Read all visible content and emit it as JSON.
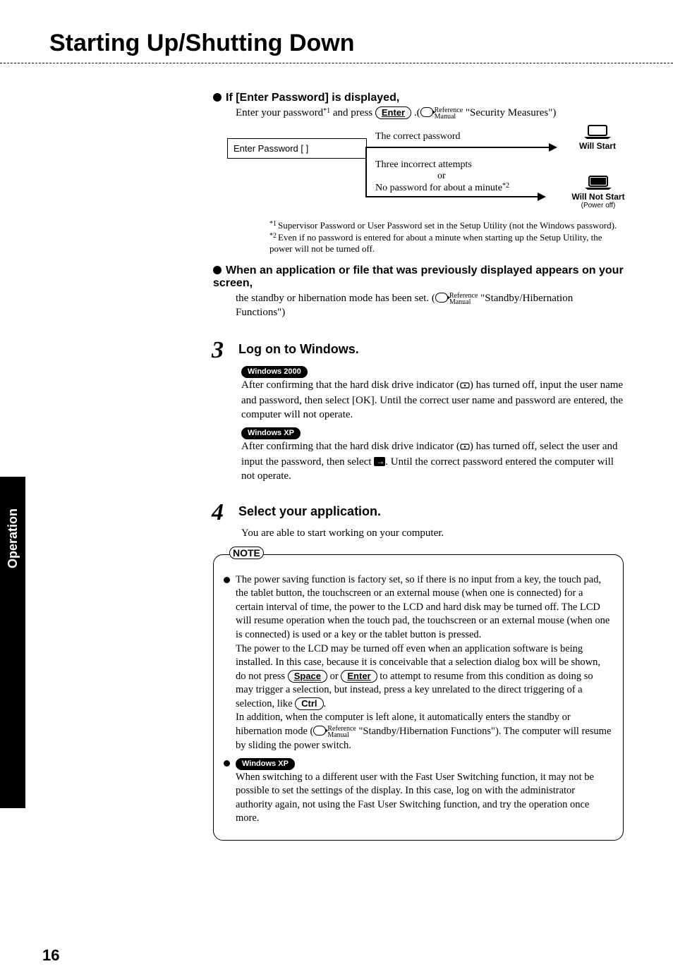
{
  "page": {
    "title": "Starting Up/Shutting Down",
    "number": "16",
    "tab": "Operation"
  },
  "section1": {
    "heading": "If [Enter Password] is displayed,",
    "intro_a": "Enter your password",
    "intro_sup": "*1",
    "intro_b": " and press ",
    "key_enter": "Enter",
    "intro_c": " .(",
    "ref1": "Reference",
    "ref2": "Manual",
    "intro_d": " \"Security Measures\")",
    "diagram": {
      "input_label": "Enter Password [       ]",
      "correct": "The correct password",
      "incorrect1": "Three incorrect attempts",
      "or": "or",
      "incorrect2": "No password for about a minute",
      "sup2": "*2",
      "will_start": "Will Start",
      "will_not_start": "Will Not Start",
      "power_off": "(Power off)"
    },
    "footnotes": {
      "f1": "Supervisor Password or User Password set in the Setup Utility (not the Windows password).",
      "f2": "Even if no password is entered for about a minute when starting up the Setup Utility, the power will not be turned off."
    }
  },
  "section2": {
    "heading": "When an application or file that was previously displayed appears on your screen,",
    "body_a": "the standby or hibernation mode has been set. (",
    "ref1": "Reference",
    "ref2": "Manual",
    "body_b": " \"Standby/Hibernation Functions\")"
  },
  "step3": {
    "num": "3",
    "title": "Log on to Windows.",
    "pill_2000": "Windows 2000",
    "body_2000": "After confirming that the hard disk drive indicator (    ) has turned off, input the user name and password, then select [OK].  Until the correct user name and password are entered, the computer will not operate.",
    "pill_xp": "Windows XP",
    "body_xp_a": "After confirming that the hard disk drive indicator (    ) has turned off, select the user and input the password, then select ",
    "body_xp_b": ".  Until the correct password entered the computer will not operate."
  },
  "step4": {
    "num": "4",
    "title": "Select your application.",
    "body": "You are able to start working on your computer."
  },
  "note": {
    "label": "NOTE",
    "b1_a": "The power saving function is factory set, so if there is no input from a key, the touch pad, the tablet button, the touchscreen or an external mouse (when one is connected) for a certain interval of time, the power to the LCD and hard disk may be turned off. The LCD will resume operation when the touch pad, the touchscreen or an external mouse (when one is connected) is used or a key or the tablet button is pressed.",
    "b1_b": "The power to the LCD may be turned off even when an application software is being installed.  In this case, because it is conceivable that a selection dialog box will be shown, do not press ",
    "key_space": "Space",
    "b1_c": " or ",
    "key_enter": "Enter",
    "b1_d": " to attempt to resume from this condition as doing so may trigger a selection, but instead, press a key unrelated to the direct triggering of a selection, like ",
    "key_ctrl": "Ctrl",
    "b1_e": ".",
    "b1_f": "In addition, when the computer is left alone, it automatically enters the standby or hibernation mode (",
    "ref1": "Reference",
    "ref2": "Manual",
    "b1_g": "  \"Standby/Hibernation Functions\").  The computer will resume by sliding the power switch.",
    "b2_pill": "Windows XP",
    "b2": "When switching to a different user with the Fast User Switching function, it may not be possible to set the settings of the display. In this case, log on with the administrator authority again, not using the Fast User Switching function, and try the operation once more."
  }
}
